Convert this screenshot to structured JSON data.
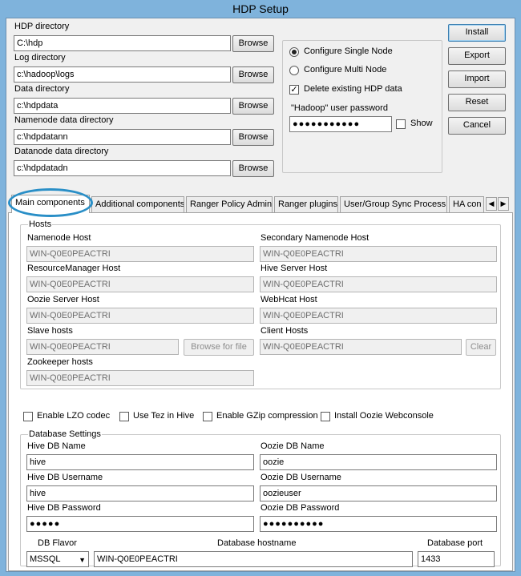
{
  "window": {
    "title": "HDP Setup"
  },
  "dirs": {
    "hdp_label": "HDP directory",
    "hdp_value": "C:\\hdp",
    "log_label": "Log directory",
    "log_value": "c:\\hadoop\\logs",
    "data_label": "Data directory",
    "data_value": "c:\\hdpdata",
    "namenode_label": "Namenode data directory",
    "namenode_value": "c:\\hdpdatann",
    "datanode_label": "Datanode data directory",
    "datanode_value": "c:\\hdpdatadn",
    "browse_label": "Browse"
  },
  "options": {
    "single_node": "Configure Single Node",
    "multi_node": "Configure Multi Node",
    "delete_existing": "Delete existing HDP data",
    "password_label": "\"Hadoop\" user password",
    "password_value": "●●●●●●●●●●●",
    "show_label": "Show",
    "selected": "single_node"
  },
  "actions": {
    "install": "Install",
    "export": "Export",
    "import": "Import",
    "reset": "Reset",
    "cancel": "Cancel"
  },
  "tabs": [
    {
      "label": "Main components",
      "active": true
    },
    {
      "label": "Additional components"
    },
    {
      "label": "Ranger Policy Admin"
    },
    {
      "label": "Ranger plugins"
    },
    {
      "label": "User/Group Sync Process"
    },
    {
      "label": "HA con"
    }
  ],
  "hosts": {
    "legend": "Hosts",
    "namenode_label": "Namenode Host",
    "namenode_value": "WIN-Q0E0PEACTRI",
    "secondary_label": "Secondary Namenode Host",
    "secondary_value": "WIN-Q0E0PEACTRI",
    "rm_label": "ResourceManager Host",
    "rm_value": "WIN-Q0E0PEACTRI",
    "hive_label": "Hive Server Host",
    "hive_value": "WIN-Q0E0PEACTRI",
    "oozie_label": "Oozie Server Host",
    "oozie_value": "WIN-Q0E0PEACTRI",
    "webhcat_label": "WebHcat Host",
    "webhcat_value": "WIN-Q0E0PEACTRI",
    "slave_label": "Slave hosts",
    "slave_value": "WIN-Q0E0PEACTRI",
    "browse_file_label": "Browse for file",
    "client_label": "Client Hosts",
    "client_value": "WIN-Q0E0PEACTRI",
    "clear_label": "Clear",
    "zk_label": "Zookeeper hosts",
    "zk_value": "WIN-Q0E0PEACTRI"
  },
  "checks": {
    "lzo": "Enable LZO codec",
    "tez": "Use Tez in Hive",
    "gzip": "Enable GZip compression",
    "oozie_web": "Install Oozie Webconsole"
  },
  "db": {
    "legend": "Database Settings",
    "hive_name_label": "Hive DB Name",
    "hive_name_value": "hive",
    "oozie_name_label": "Oozie DB Name",
    "oozie_name_value": "oozie",
    "hive_user_label": "Hive DB Username",
    "hive_user_value": "hive",
    "oozie_user_label": "Oozie DB Username",
    "oozie_user_value": "oozieuser",
    "hive_pw_label": "Hive DB Password",
    "hive_pw_value": "●●●●●",
    "oozie_pw_label": "Oozie DB Password",
    "oozie_pw_value": "●●●●●●●●●●",
    "flavor_label": "DB Flavor",
    "flavor_value": "MSSQL",
    "hostname_label": "Database hostname",
    "hostname_value": "WIN-Q0E0PEACTRI",
    "port_label": "Database port",
    "port_value": "1433"
  },
  "colors": {
    "highlight_circle": "#2a8fc7",
    "window_frame": "#7fb3dc"
  }
}
